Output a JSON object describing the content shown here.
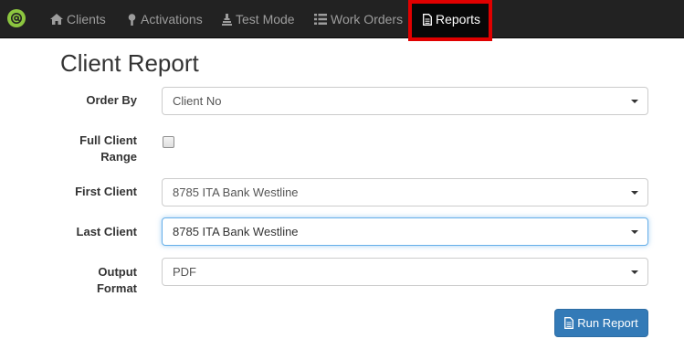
{
  "nav": {
    "items": [
      {
        "label": "Clients",
        "icon": "home-icon"
      },
      {
        "label": "Activations",
        "icon": "wrench-icon"
      },
      {
        "label": "Test Mode",
        "icon": "beaker-icon"
      },
      {
        "label": "Work Orders",
        "icon": "list-icon"
      },
      {
        "label": "Reports",
        "icon": "document-icon",
        "active": true
      }
    ],
    "highlight_color": "#e00000"
  },
  "page": {
    "title": "Client Report"
  },
  "form": {
    "order_by": {
      "label": "Order By",
      "value": "Client No"
    },
    "full_client_range": {
      "label_line1": "Full Client",
      "label_line2": "Range",
      "checked": false
    },
    "first_client": {
      "label": "First Client",
      "value": "8785 ITA Bank Westline"
    },
    "last_client": {
      "label": "Last Client",
      "value": "8785 ITA Bank Westline"
    },
    "output_format": {
      "label_line1": "Output",
      "label_line2": "Format",
      "value": "PDF"
    },
    "run_button": {
      "label": "Run Report",
      "color": "#337ab7"
    }
  }
}
